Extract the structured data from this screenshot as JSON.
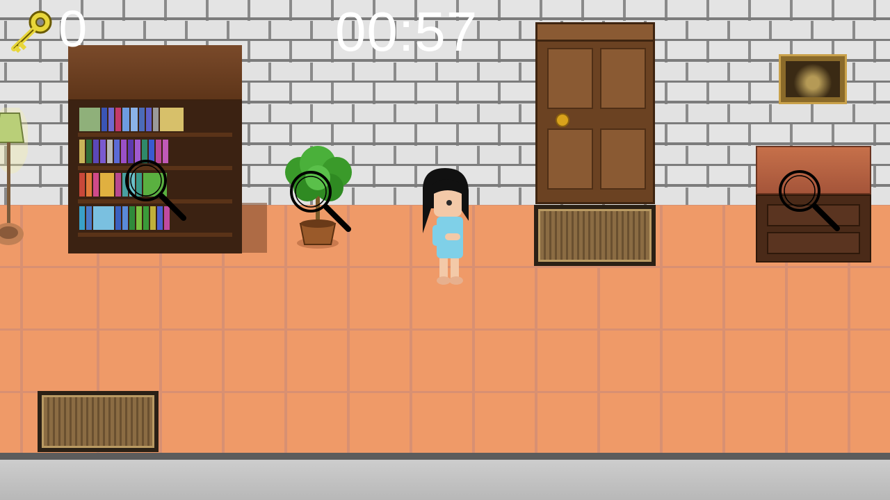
{
  "hud": {
    "key_icon": "key-icon",
    "key_count": "0",
    "timer": "00:57",
    "key_color": "#e8d63a"
  },
  "scene": {
    "wall_color": "#e4e4e4",
    "floor_color": "#ef9a68"
  },
  "hotspots": [
    {
      "target": "bookshelf",
      "icon": "magnifier-icon"
    },
    {
      "target": "plant",
      "icon": "magnifier-icon"
    },
    {
      "target": "dresser",
      "icon": "magnifier-icon"
    }
  ]
}
